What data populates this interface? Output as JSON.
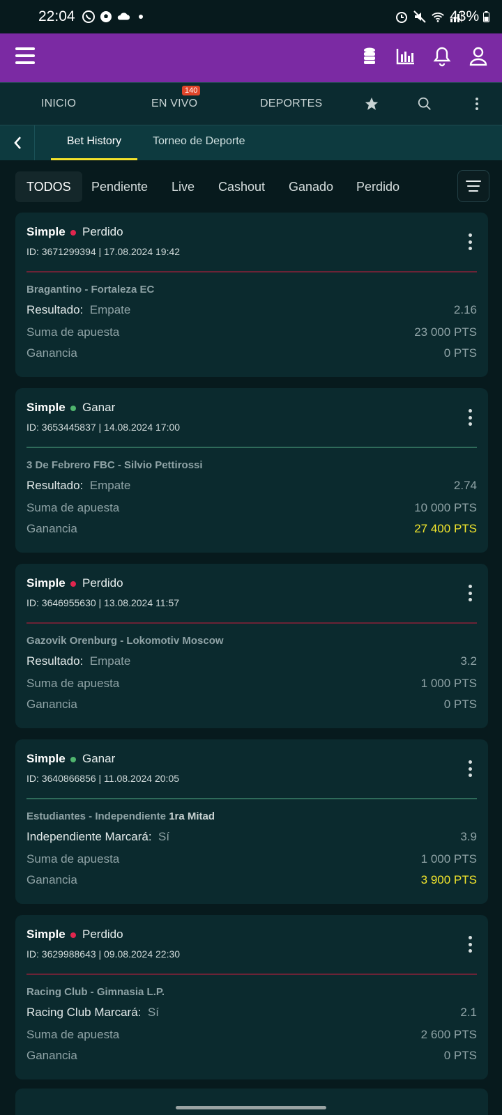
{
  "status_bar": {
    "time": "22:04",
    "battery": "43%",
    "icons_left": [
      "whatsapp-icon",
      "soccer-ball-icon",
      "cloud-icon",
      "dot-icon"
    ],
    "icons_right": [
      "alarm-icon",
      "mute-icon",
      "wifi-icon",
      "signal-icon",
      "battery-icon"
    ]
  },
  "header": {
    "icons": [
      "menu-icon",
      "coins-icon",
      "stats-icon",
      "bell-icon",
      "user-icon"
    ],
    "accent": "#7b2aa3"
  },
  "main_nav": {
    "inicio": "INICIO",
    "en_vivo": "EN VIVO",
    "en_vivo_badge": "140",
    "deportes": "DEPORTES"
  },
  "sub_nav": {
    "tabs": [
      "Bet History",
      "Torneo de Deporte"
    ],
    "active": "Bet History"
  },
  "filters": {
    "chips": [
      "TODOS",
      "Pendiente",
      "Live",
      "Cashout",
      "Ganado",
      "Perdido"
    ],
    "active": "TODOS"
  },
  "bets": [
    {
      "type": "Simple",
      "status": "Perdido",
      "status_color": "#e0264e",
      "id_line": "ID: 3671299394  |  17.08.2024 19:42",
      "match": "Bragantino - Fortaleza EC",
      "match_extra": "",
      "market": "Resultado:",
      "selection": "Empate",
      "odds": "2.16",
      "stake_label": "Suma de apuesta",
      "stake": "23 000 PTS",
      "win_label": "Ganancia",
      "win": "0 PTS",
      "won": false
    },
    {
      "type": "Simple",
      "status": "Ganar",
      "status_color": "#4fb56e",
      "id_line": "ID: 3653445837  |  14.08.2024 17:00",
      "match": "3 De Febrero FBC - Silvio Pettirossi",
      "match_extra": "",
      "market": "Resultado:",
      "selection": "Empate",
      "odds": "2.74",
      "stake_label": "Suma de apuesta",
      "stake": "10 000 PTS",
      "win_label": "Ganancia",
      "win": "27 400 PTS",
      "won": true
    },
    {
      "type": "Simple",
      "status": "Perdido",
      "status_color": "#e0264e",
      "id_line": "ID: 3646955630  |  13.08.2024 11:57",
      "match": "Gazovik Orenburg - Lokomotiv Moscow",
      "match_extra": "",
      "market": "Resultado:",
      "selection": "Empate",
      "odds": "3.2",
      "stake_label": "Suma de apuesta",
      "stake": "1 000 PTS",
      "win_label": "Ganancia",
      "win": "0 PTS",
      "won": false
    },
    {
      "type": "Simple",
      "status": "Ganar",
      "status_color": "#4fb56e",
      "id_line": "ID: 3640866856  |  11.08.2024 20:05",
      "match": "Estudiantes - Independiente",
      "match_extra": "1ra Mitad",
      "market": "Independiente Marcará:",
      "selection": "Sí",
      "odds": "3.9",
      "stake_label": "Suma de apuesta",
      "stake": "1 000 PTS",
      "win_label": "Ganancia",
      "win": "3 900 PTS",
      "won": true
    },
    {
      "type": "Simple",
      "status": "Perdido",
      "status_color": "#e0264e",
      "id_line": "ID: 3629988643  |  09.08.2024 22:30",
      "match": "Racing Club - Gimnasia L.P.",
      "match_extra": "",
      "market": "Racing Club Marcará:",
      "selection": "Sí",
      "odds": "2.1",
      "stake_label": "Suma de apuesta",
      "stake": "2 600 PTS",
      "win_label": "Ganancia",
      "win": "0 PTS",
      "won": false
    }
  ]
}
